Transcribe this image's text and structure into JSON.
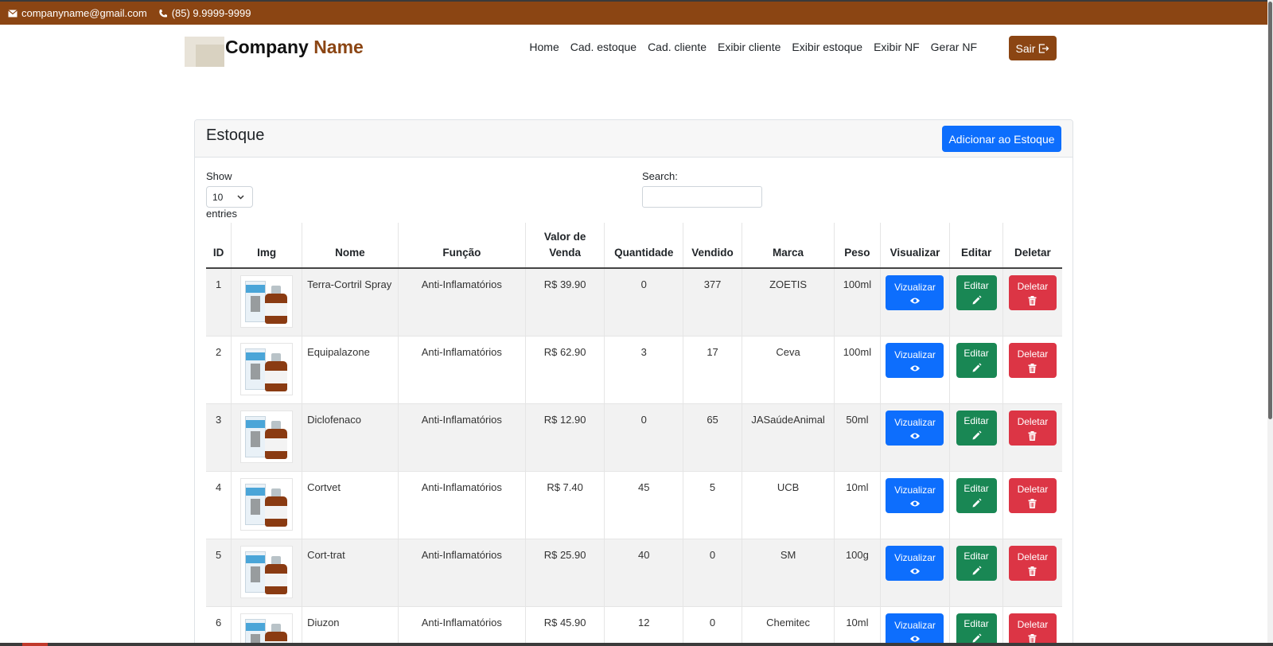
{
  "topbar": {
    "email": "companyname@gmail.com",
    "phone": "(85) 9.9999-9999",
    "email_icon": "envelope-icon",
    "phone_icon": "phone-icon",
    "color": "#8b4513"
  },
  "navbar": {
    "brand_main": "Company",
    "brand_accent": "Name",
    "links": [
      "Home",
      "Cad. estoque",
      "Cad. cliente",
      "Exibir cliente",
      "Exibir estoque",
      "Exibir NF",
      "Gerar NF"
    ],
    "logout_label": "Sair",
    "logout_icon": "logout-icon"
  },
  "card": {
    "title": "Estoque",
    "add_button": "Adicionar ao Estoque"
  },
  "controls": {
    "show_label": "Show",
    "length_value": "10",
    "entries_label": "entries",
    "search_label": "Search:",
    "search_value": ""
  },
  "table": {
    "headers": {
      "id": "ID",
      "img": "Img",
      "nome": "Nome",
      "funcao": "Função",
      "valor_line1": "Valor de",
      "valor_line2": "Venda",
      "quantidade": "Quantidade",
      "vendido": "Vendido",
      "marca": "Marca",
      "peso": "Peso",
      "visualizar": "Visualizar",
      "editar": "Editar",
      "deletar": "Deletar"
    },
    "rows": [
      {
        "id": "1",
        "nome": "Terra-Cortril Spray",
        "funcao": "Anti-Inflamatórios",
        "valor": "R$ 39.90",
        "quantidade": "0",
        "vendido": "377",
        "marca": "ZOETIS",
        "peso": "100ml"
      },
      {
        "id": "2",
        "nome": "Equipalazone",
        "funcao": "Anti-Inflamatórios",
        "valor": "R$ 62.90",
        "quantidade": "3",
        "vendido": "17",
        "marca": "Ceva",
        "peso": "100ml"
      },
      {
        "id": "3",
        "nome": "Diclofenaco",
        "funcao": "Anti-Inflamatórios",
        "valor": "R$ 12.90",
        "quantidade": "0",
        "vendido": "65",
        "marca": "JASaúdeAnimal",
        "peso": "50ml"
      },
      {
        "id": "4",
        "nome": "Cortvet",
        "funcao": "Anti-Inflamatórios",
        "valor": "R$ 7.40",
        "quantidade": "45",
        "vendido": "5",
        "marca": "UCB",
        "peso": "10ml"
      },
      {
        "id": "5",
        "nome": "Cort-trat",
        "funcao": "Anti-Inflamatórios",
        "valor": "R$ 25.90",
        "quantidade": "40",
        "vendido": "0",
        "marca": "SM",
        "peso": "100g"
      },
      {
        "id": "6",
        "nome": "Diuzon",
        "funcao": "Anti-Inflamatórios",
        "valor": "R$ 45.90",
        "quantidade": "12",
        "vendido": "0",
        "marca": "Chemitec",
        "peso": "10ml"
      }
    ],
    "actions": {
      "view_label": "Vizualizar",
      "edit_label": "Editar",
      "delete_label": "Deletar",
      "view_icon": "eye-icon",
      "edit_icon": "pencil-icon",
      "delete_icon": "trash-icon"
    }
  }
}
